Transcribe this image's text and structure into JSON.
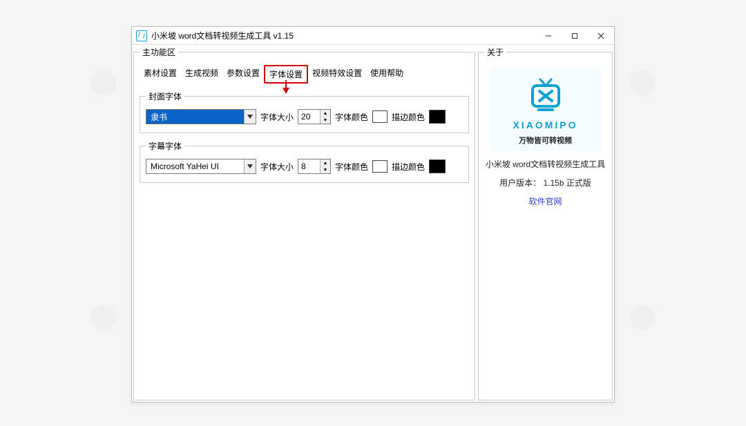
{
  "window": {
    "title": "小米坡 word文档转视频生成工具 v1.15"
  },
  "panels": {
    "main_legend": "主功能区",
    "about_legend": "关于"
  },
  "tabs": [
    {
      "id": "material",
      "label": "素材设置"
    },
    {
      "id": "genvideo",
      "label": "生成视频"
    },
    {
      "id": "params",
      "label": "参数设置"
    },
    {
      "id": "font",
      "label": "字体设置"
    },
    {
      "id": "vfx",
      "label": "视频特效设置"
    },
    {
      "id": "help",
      "label": "使用帮助"
    }
  ],
  "active_tab": "font",
  "cover_font": {
    "legend": "封面字体",
    "font_name": "隶书",
    "size_label": "字体大小",
    "size_value": "20",
    "color_label": "字体颜色",
    "stroke_label": "描边颜色",
    "color_hex": "#ffffff",
    "stroke_hex": "#000000"
  },
  "subtitle_font": {
    "legend": "字幕字体",
    "font_name": "Microsoft YaHei UI",
    "size_label": "字体大小",
    "size_value": "8",
    "color_label": "字体颜色",
    "stroke_label": "描边颜色",
    "color_hex": "#ffffff",
    "stroke_hex": "#000000"
  },
  "about": {
    "brand": "XIAOMIPO",
    "slogan": "万物皆可转视频",
    "product": "小米坡 word文档转视频生成工具",
    "version_line": "用户版本： 1.15b 正式版",
    "site_link": "软件官网"
  }
}
